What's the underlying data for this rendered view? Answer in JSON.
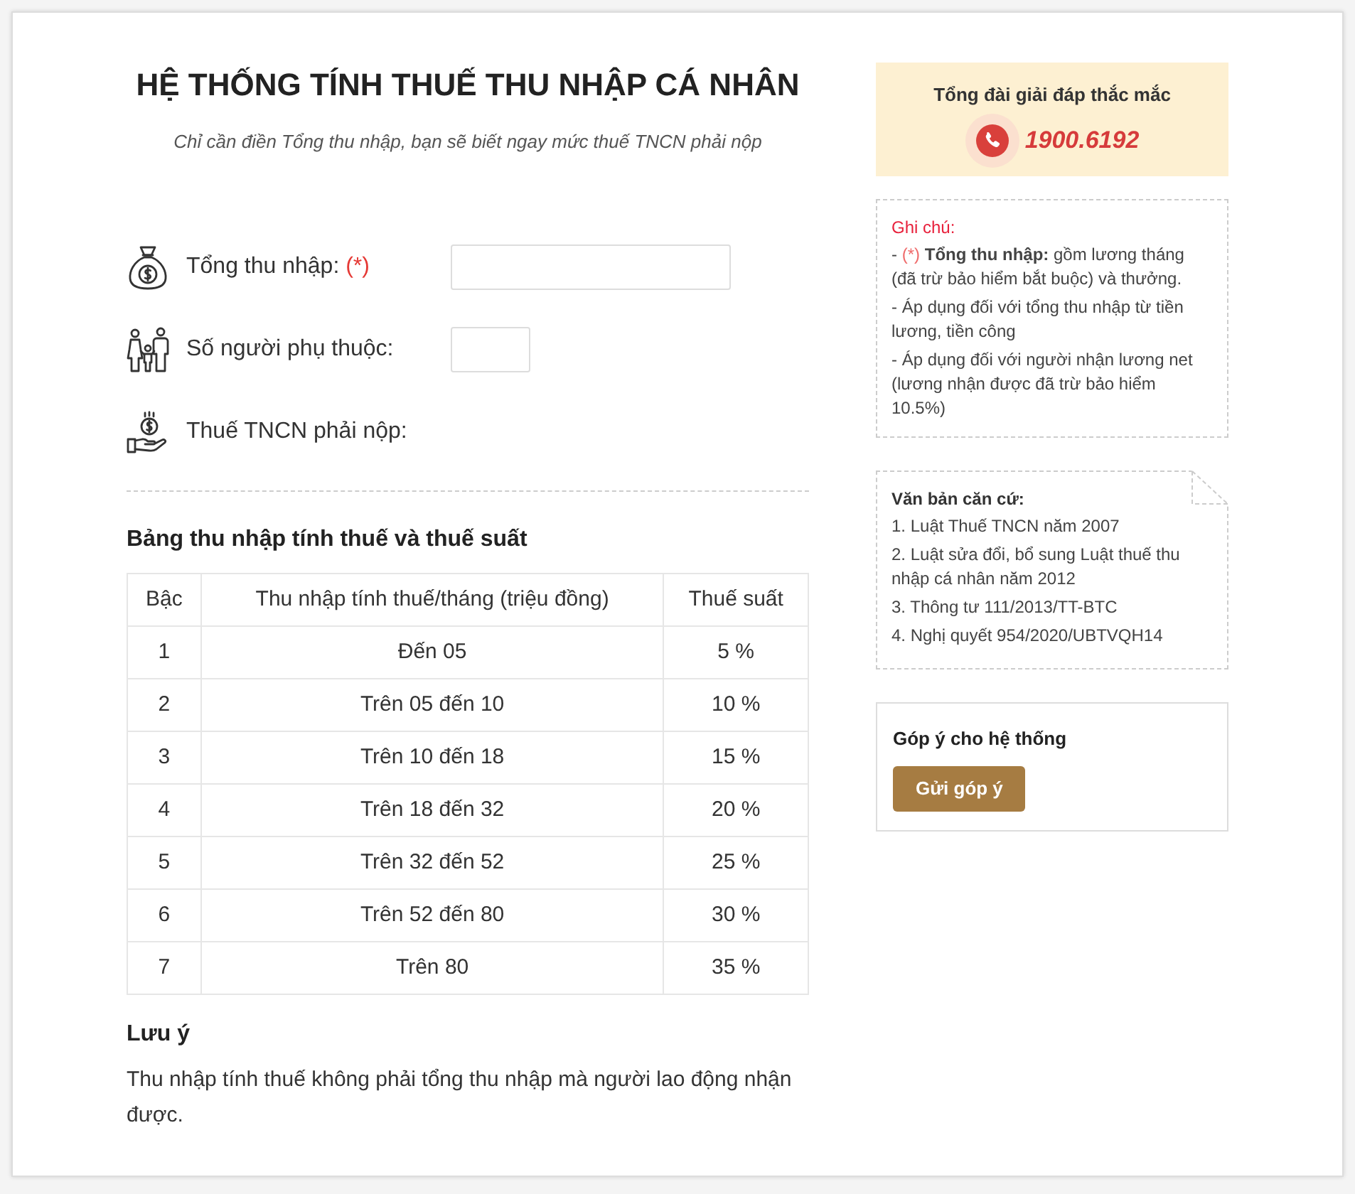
{
  "header": {
    "title": "HỆ THỐNG TÍNH THUẾ THU NHẬP CÁ NHÂN",
    "subtitle": "Chỉ cần điền Tổng thu nhập, bạn sẽ biết ngay mức thuế TNCN phải nộp"
  },
  "form": {
    "fields": [
      {
        "kind": "income",
        "label": "Tổng thu nhập:",
        "required_mark": "(*)"
      },
      {
        "kind": "dependents",
        "label": "Số người phụ thuộc:"
      },
      {
        "kind": "tax",
        "label": "Thuế TNCN phải nộp:"
      }
    ]
  },
  "tax_table": {
    "title": "Bảng thu nhập tính thuế và thuế suất",
    "columns": [
      "Bậc",
      "Thu nhập tính thuế/tháng (triệu đồng)",
      "Thuế suất"
    ],
    "rows": [
      [
        "1",
        "Đến 05",
        "5 %"
      ],
      [
        "2",
        "Trên 05 đến 10",
        "10 %"
      ],
      [
        "3",
        "Trên 10 đến 18",
        "15 %"
      ],
      [
        "4",
        "Trên 18 đến 32",
        "20 %"
      ],
      [
        "5",
        "Trên 32 đến 52",
        "25 %"
      ],
      [
        "6",
        "Trên 52 đến 80",
        "30 %"
      ],
      [
        "7",
        "Trên 80",
        "35 %"
      ]
    ]
  },
  "notice": {
    "title": "Lưu ý",
    "text": "Thu nhập tính thuế không phải tổng thu nhập mà người lao động nhận được."
  },
  "sidebar": {
    "hotline": {
      "title": "Tổng đài giải đáp thắc mắc",
      "number": "1900.6192"
    },
    "notes": {
      "title": "Ghi chú:",
      "items": [
        {
          "dash": "-",
          "mark": "(*)",
          "text": "**Tổng thu nhập:** gồm lương tháng (đã trừ bảo hiểm bắt buộc) và thưởng."
        },
        {
          "dash": "-",
          "text": "Áp dụng đối với tổng thu nhập từ tiền lương, tiền công"
        },
        {
          "dash": "-",
          "text": "Áp dụng đối với người nhận lương net (lương nhận được đã trừ bảo hiểm 10.5%)"
        }
      ]
    },
    "references": {
      "title": "Văn bản căn cứ:",
      "items": [
        "1. Luật Thuế TNCN năm 2007",
        "2. Luật sửa đổi, bổ sung Luật thuế thu nhập cá nhân năm 2012",
        "3. Thông tư 111/2013/TT-BTC",
        "4. Nghị quyết 954/2020/UBTVQH14"
      ]
    },
    "feedback": {
      "title": "Góp ý cho hệ thống",
      "button": "Gửi góp ý"
    }
  }
}
